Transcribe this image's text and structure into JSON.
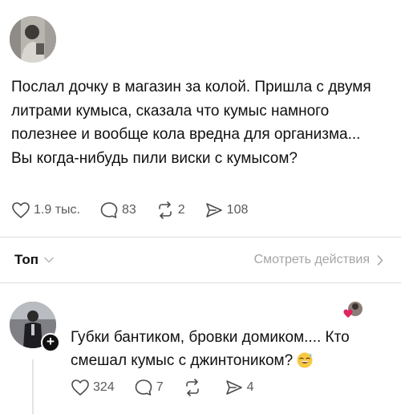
{
  "post": {
    "avatar_icon": "user-avatar",
    "paragraphs": [
      "Послал дочку в магазин за колой. Пришла с двумя литрами кумыса, сказала что кумыс намного полезнее и вообще кола вредна для организма...",
      "Вы когда-нибудь пили виски с кумысом?"
    ],
    "actions": {
      "likes": "1.9 тыс.",
      "comments": "83",
      "reposts": "2",
      "shares": "108"
    }
  },
  "sort_bar": {
    "label": "Топ",
    "view_activity": "Смотреть действия"
  },
  "reply": {
    "avatar_icon": "user-avatar",
    "author": "",
    "text": "Губки бантиком, бровки домиком.... Кто смешал кумыс с джинтоником?",
    "emoji": "sweat-smile-emoji",
    "actions": {
      "likes": "324",
      "comments": "7",
      "reposts": "",
      "shares": "4"
    }
  },
  "colors": {
    "text": "#101010",
    "muted": "#5a5a5a",
    "divider": "#dcdcdc",
    "heart_red": "#e0245e"
  }
}
